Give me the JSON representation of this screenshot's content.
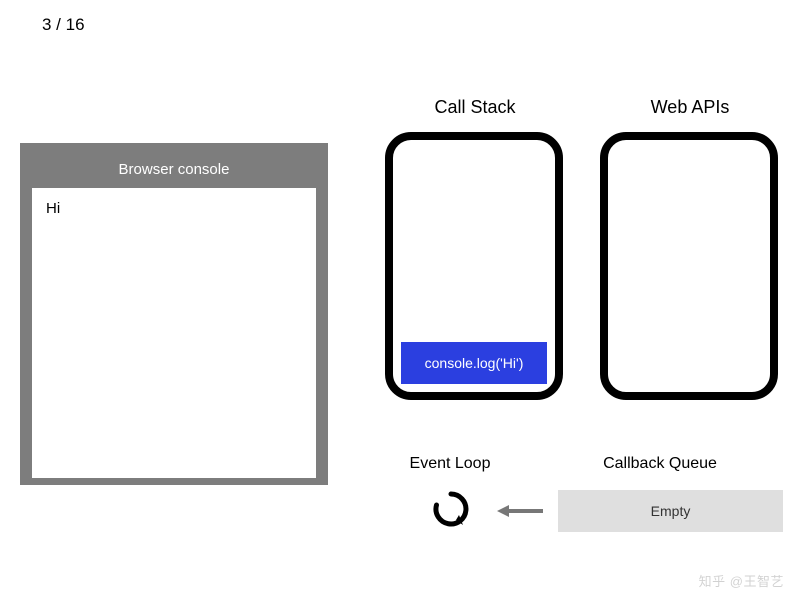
{
  "page": {
    "current": 3,
    "total": 16,
    "display": "3 / 16"
  },
  "console": {
    "title": "Browser console",
    "lines": [
      "Hi"
    ]
  },
  "sections": {
    "callStack": {
      "title": "Call Stack",
      "frames": [
        "console.log('Hi')"
      ]
    },
    "webApis": {
      "title": "Web APIs",
      "items": []
    },
    "eventLoop": {
      "title": "Event Loop"
    },
    "callbackQueue": {
      "title": "Callback Queue",
      "state": "Empty",
      "items": []
    }
  },
  "colors": {
    "frame": "#2b3fe0",
    "consoleChrome": "#7d7d7d",
    "queueBox": "#dfdfdf"
  },
  "watermark": {
    "site": "知乎",
    "handle": "@王智艺"
  }
}
